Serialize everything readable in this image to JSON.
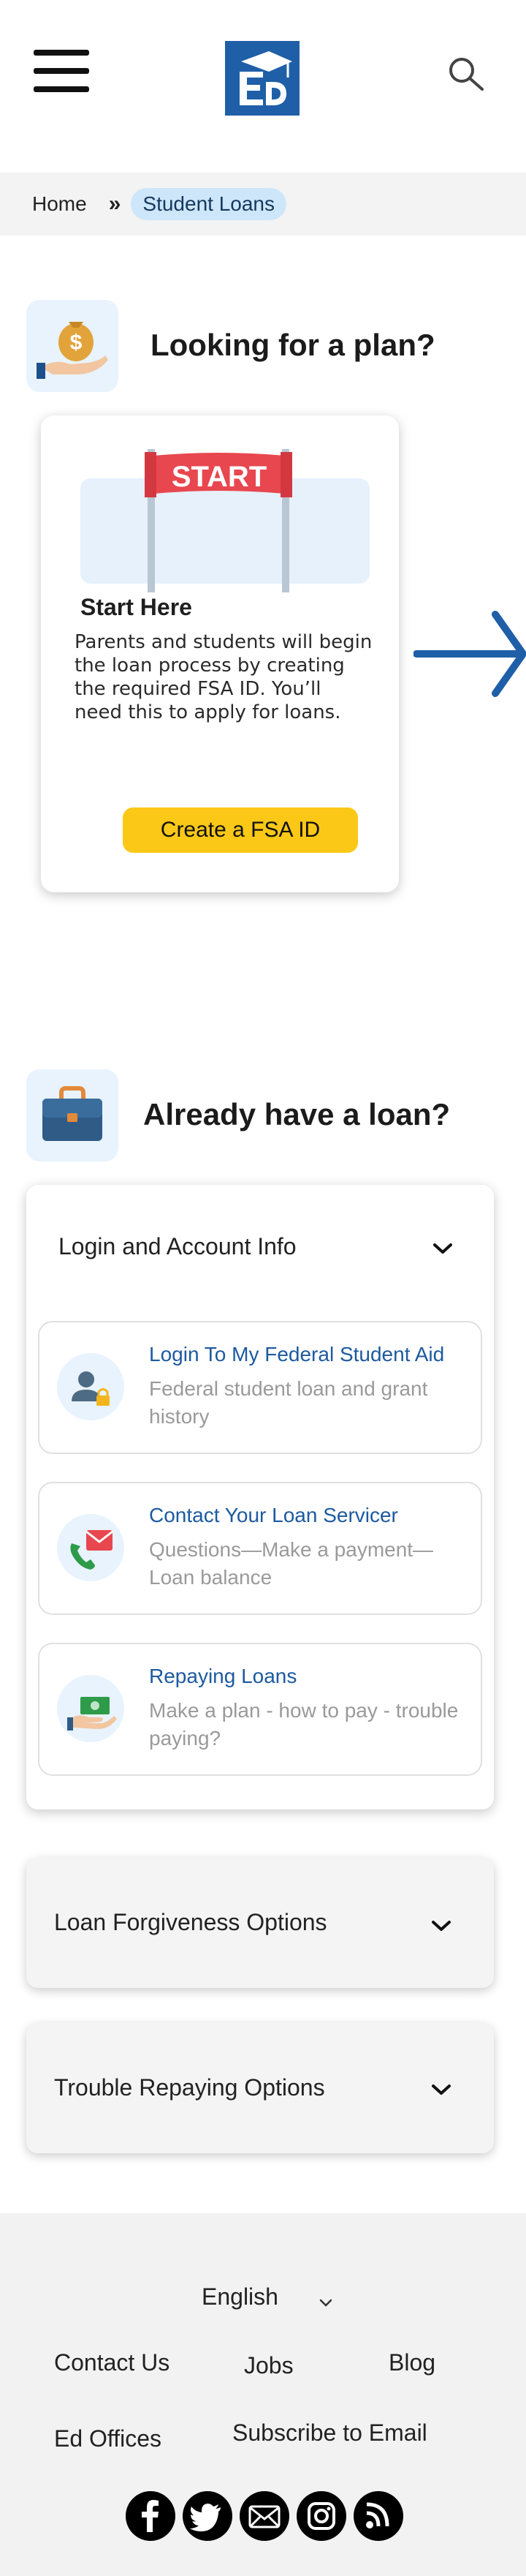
{
  "header": {
    "menu_icon": "hamburger-menu-icon",
    "logo_name": "ed-logo",
    "search_icon": "search-icon"
  },
  "breadcrumb": {
    "home": "Home",
    "separator": "»",
    "current": "Student Loans"
  },
  "plan_section": {
    "title": "Looking for a plan?",
    "icon": "money-bag-icon",
    "card": {
      "banner_text": "START",
      "title": "Start Here",
      "description": "Parents and students will begin the loan process by creating the required FSA ID. You’ll need this to apply for loans.",
      "button": "Create a FSA ID"
    },
    "next_icon": "arrow-right-icon"
  },
  "loan_section": {
    "title": "Already have a loan?",
    "icon": "briefcase-icon",
    "panel": {
      "title": "Login and Account Info",
      "links": [
        {
          "title": "Login To My Federal Student Aid",
          "subtitle": "Federal student loan and grant history",
          "icon": "user-lock-icon"
        },
        {
          "title": "Contact Your Loan Servicer",
          "subtitle": "Questions—Make a payment—Loan balance",
          "icon": "phone-mail-icon"
        },
        {
          "title": "Repaying Loans",
          "subtitle": "Make a plan - how to pay - trouble paying?",
          "icon": "money-hand-icon"
        }
      ]
    },
    "accordions": [
      {
        "title": "Loan Forgiveness Options"
      },
      {
        "title": "Trouble Repaying Options"
      }
    ]
  },
  "footer": {
    "language": "English",
    "links": {
      "contact": "Contact Us",
      "jobs": "Jobs",
      "blog": "Blog",
      "offices": "Ed Offices",
      "subscribe": "Subscribe to Email"
    },
    "socials": [
      "facebook-icon",
      "twitter-icon",
      "email-icon",
      "instagram-icon",
      "rss-icon"
    ]
  },
  "colors": {
    "brand_blue": "#1f5fa8",
    "link_blue": "#1d5aa0",
    "button_yellow": "#fcc817",
    "icon_bg": "#e8f3fd",
    "crumb_bg": "#cde6fa"
  }
}
